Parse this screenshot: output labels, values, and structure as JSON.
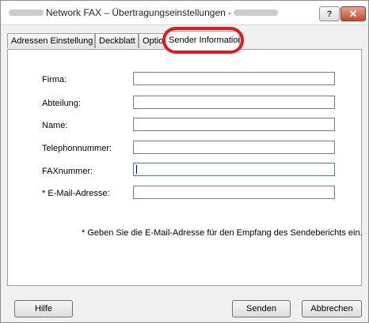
{
  "window": {
    "title": "Network FAX – Übertragungseinstellungen -",
    "help_glyph": "?",
    "close_glyph": "✕"
  },
  "tabs": [
    {
      "label": "Adressen Einstellung"
    },
    {
      "label": "Deckblatt"
    },
    {
      "label": "Optior"
    },
    {
      "label": "Sender Information",
      "active": true
    }
  ],
  "form": {
    "fields": [
      {
        "label": "Firma:",
        "value": ""
      },
      {
        "label": "Abteilung:",
        "value": ""
      },
      {
        "label": "Name:",
        "value": ""
      },
      {
        "label": "Telephonnummer:",
        "value": ""
      },
      {
        "label": "FAXnummer:",
        "value": ""
      },
      {
        "label": "* E-Mail-Adresse:",
        "value": ""
      }
    ],
    "note": "* Geben Sie die E-Mail-Adresse für den Empfang des Sendeberichts ein."
  },
  "buttons": {
    "help": "Hilfe",
    "send": "Senden",
    "cancel": "Abbrechen"
  },
  "colors": {
    "highlight": "#e8161b",
    "close_button": "#c44b2a"
  }
}
